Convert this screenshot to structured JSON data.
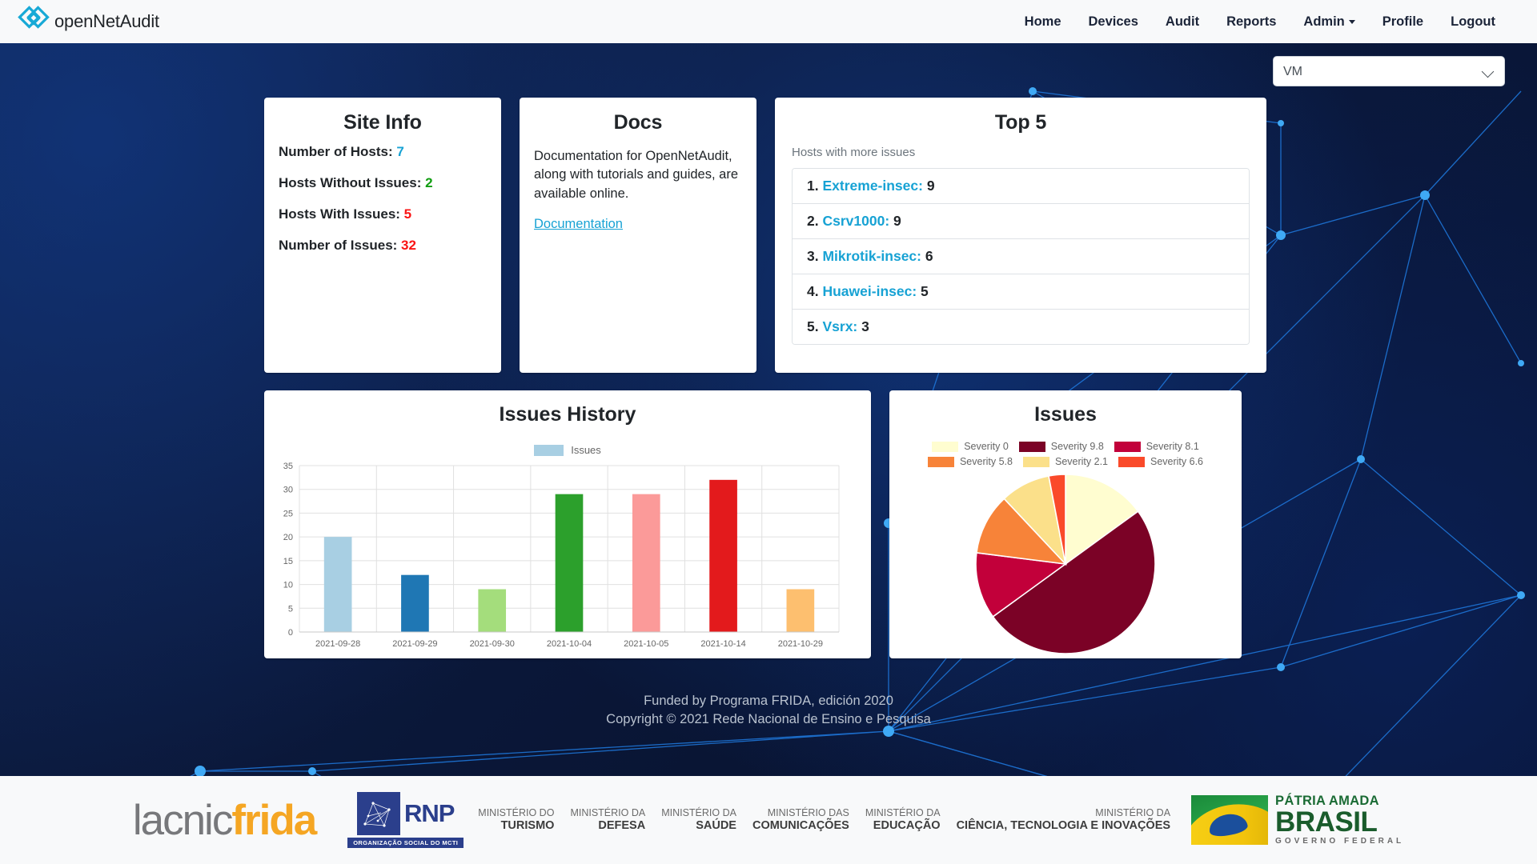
{
  "navbar": {
    "brand": "openNetAudit",
    "links": [
      {
        "label": "Home"
      },
      {
        "label": "Devices"
      },
      {
        "label": "Audit"
      },
      {
        "label": "Reports"
      },
      {
        "label": "Admin",
        "has_caret": true
      },
      {
        "label": "Profile"
      },
      {
        "label": "Logout"
      }
    ]
  },
  "site_select": {
    "value": "VM",
    "options": [
      "VM"
    ]
  },
  "site_info": {
    "title": "Site Info",
    "rows": [
      {
        "label": "Number of Hosts:",
        "value": "7",
        "color": "#17a2d4"
      },
      {
        "label": "Hosts Without Issues:",
        "value": "2",
        "color": "#109d10"
      },
      {
        "label": "Hosts With Issues:",
        "value": "5",
        "color": "#fa1414"
      },
      {
        "label": "Number of Issues:",
        "value": "32",
        "color": "#fa1414"
      }
    ]
  },
  "docs": {
    "title": "Docs",
    "body": "Documentation for OpenNetAudit, along with tutorials and guides, are available online.",
    "link_label": "Documentation"
  },
  "top5": {
    "title": "Top 5",
    "subtitle": "Hosts with more issues",
    "items": [
      {
        "rank": "1.",
        "host": "Extreme-insec:",
        "count": "9"
      },
      {
        "rank": "2.",
        "host": "Csrv1000:",
        "count": "9"
      },
      {
        "rank": "3.",
        "host": "Mikrotik-insec:",
        "count": "6"
      },
      {
        "rank": "4.",
        "host": "Huawei-insec:",
        "count": "5"
      },
      {
        "rank": "5.",
        "host": "Vsrx:",
        "count": "3"
      }
    ]
  },
  "chart_data": [
    {
      "type": "bar",
      "title": "Issues History",
      "xlabel": "",
      "ylabel": "",
      "ylim": [
        0,
        35
      ],
      "yticks": [
        0,
        5,
        10,
        15,
        20,
        25,
        30,
        35
      ],
      "grid": true,
      "legend_position": "top",
      "legend": [
        "Issues"
      ],
      "legend_swatch_color": "#a8cfe3",
      "categories": [
        "2021-09-28",
        "2021-09-29",
        "2021-09-30",
        "2021-10-04",
        "2021-10-05",
        "2021-10-14",
        "2021-10-29"
      ],
      "values": [
        20,
        12,
        9,
        29,
        29,
        32,
        9
      ],
      "bar_colors": [
        "#a8cfe3",
        "#1f77b4",
        "#a4dd7c",
        "#2ca02c",
        "#fb9a99",
        "#e31a1c",
        "#fdbf6f"
      ]
    },
    {
      "type": "pie",
      "title": "Issues",
      "legend_position": "top",
      "labels": [
        "Severity 0",
        "Severity 9.8",
        "Severity 8.1",
        "Severity 5.8",
        "Severity 2.1",
        "Severity 6.6"
      ],
      "values": [
        15,
        50,
        12,
        11,
        9,
        3
      ],
      "colors": [
        "#fffdd0",
        "#7b0226",
        "#c2003a",
        "#f78339",
        "#fbe08a",
        "#fa4a2a"
      ]
    }
  ],
  "footer": {
    "funded": "Funded by Programa FRIDA, edición 2020",
    "copyright": "Copyright © 2021 Rede Nacional de Ensino e Pesquisa",
    "lacnic": "lacnic",
    "frida": "frida",
    "rnp_text": "RNP",
    "rnp_sub": "ORGANIZAÇÃO SOCIAL DO MCTI",
    "ministries": [
      {
        "line1": "MINISTÉRIO DO",
        "line2": "TURISMO"
      },
      {
        "line1": "MINISTÉRIO DA",
        "line2": "DEFESA"
      },
      {
        "line1": "MINISTÉRIO DA",
        "line2": "SAÚDE"
      },
      {
        "line1": "MINISTÉRIO DAS",
        "line2": "COMUNICAÇÕES"
      },
      {
        "line1": "MINISTÉRIO DA",
        "line2": "EDUCAÇÃO"
      },
      {
        "line1": "MINISTÉRIO DA",
        "line2": "CIÊNCIA, TECNOLOGIA E INOVAÇÕES"
      }
    ],
    "brasil_line1": "PÁTRIA AMADA",
    "brasil_line2": "BRASIL",
    "brasil_line3": "GOVERNO FEDERAL"
  }
}
